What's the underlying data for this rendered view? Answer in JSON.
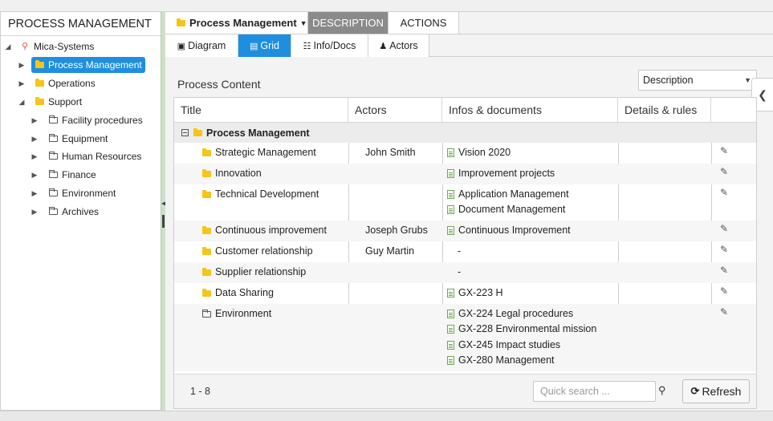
{
  "left_panel": {
    "title": "PROCESS MANAGEMENT",
    "tree": [
      {
        "label": "Mica-Systems",
        "level": 0,
        "expanded": true,
        "icon": "pin-icon"
      },
      {
        "label": "Process Management",
        "level": 1,
        "expanded": false,
        "selected": true,
        "icon": "folder-icon"
      },
      {
        "label": "Operations",
        "level": 1,
        "expanded": false,
        "icon": "folder-icon"
      },
      {
        "label": "Support",
        "level": 1,
        "expanded": true,
        "icon": "folder-icon"
      },
      {
        "label": "Facility procedures",
        "level": 2,
        "expanded": false,
        "icon": "folder-outline-icon"
      },
      {
        "label": "Equipment",
        "level": 2,
        "expanded": false,
        "icon": "folder-outline-icon"
      },
      {
        "label": "Human Resources",
        "level": 2,
        "expanded": false,
        "icon": "folder-outline-icon"
      },
      {
        "label": "Finance",
        "level": 2,
        "expanded": false,
        "icon": "folder-outline-icon"
      },
      {
        "label": "Environment",
        "level": 2,
        "expanded": false,
        "icon": "folder-outline-icon"
      },
      {
        "label": "Archives",
        "level": 2,
        "expanded": false,
        "icon": "folder-outline-icon"
      }
    ]
  },
  "header": {
    "breadcrumb": "Process Management",
    "tabs": [
      "DESCRIPTION",
      "ACTIONS"
    ],
    "active_tab": "DESCRIPTION"
  },
  "subtabs": [
    "Diagram",
    "Grid",
    "Info/Docs",
    "Actors"
  ],
  "active_subtab": "Grid",
  "content_title": "Process Content",
  "view_select": "Description",
  "grid": {
    "columns": [
      "Title",
      "Actors",
      "Infos & documents",
      "Details & rules"
    ],
    "group": "Process Management",
    "rows": [
      {
        "title": "Strategic Management",
        "folder": "filled",
        "actor": "John Smith",
        "infos": [
          "Vision 2020"
        ]
      },
      {
        "title": "Innovation",
        "folder": "filled",
        "actor": "",
        "infos": [
          "Improvement projects"
        ]
      },
      {
        "title": "Technical Development",
        "folder": "filled",
        "actor": "",
        "infos": [
          "Application Management",
          "Document Management"
        ]
      },
      {
        "title": "Continuous improvement",
        "folder": "filled",
        "actor": "Joseph Grubs",
        "infos": [
          "Continuous Improvement"
        ]
      },
      {
        "title": "Customer relationship",
        "folder": "filled",
        "actor": "Guy Martin",
        "infos": [],
        "dash": "-"
      },
      {
        "title": "Supplier relationship",
        "folder": "filled",
        "actor": "",
        "infos": [],
        "dash": "-"
      },
      {
        "title": "Data Sharing",
        "folder": "filled",
        "actor": "",
        "infos": [
          "GX-223 H"
        ]
      },
      {
        "title": "Environment",
        "folder": "outline",
        "actor": "",
        "infos": [
          "GX-224 Legal procedures",
          "GX-228 Environmental mission",
          "GX-245 Impact studies",
          "GX-280 Management"
        ]
      }
    ],
    "pager": "1 - 8",
    "search_placeholder": "Quick search ...",
    "refresh_label": "Refresh"
  },
  "colors": {
    "accent": "#1e8fe0",
    "folder": "#f5c518",
    "doc": "#6aa84f",
    "tab_active": "#8a8a8a"
  }
}
